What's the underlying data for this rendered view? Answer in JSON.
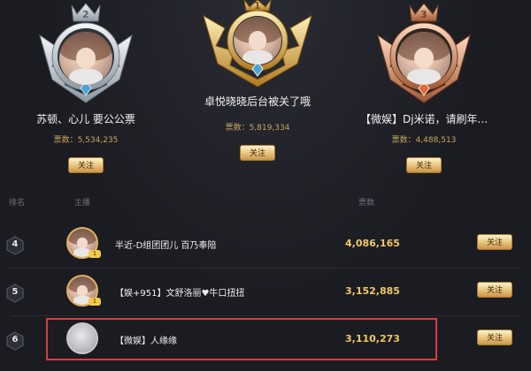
{
  "podium": [
    {
      "rank": "2",
      "name": "苏顿、心儿 要公公票",
      "fans_label": "票数：",
      "fans_value": "5,534,235",
      "follow_label": "关注",
      "tier": "silver"
    },
    {
      "rank": "1",
      "name": "卓悦晓晓后台被关了哦",
      "fans_label": "票数：",
      "fans_value": "5,819,334",
      "follow_label": "关注",
      "tier": "gold"
    },
    {
      "rank": "3",
      "name": "【微娱】Dj米诺，请刷年...",
      "fans_label": "票数：",
      "fans_value": "4,488,513",
      "follow_label": "关注",
      "tier": "bronze"
    }
  ],
  "list_header": {
    "rank": "排名",
    "host": "主播",
    "votes": "票数"
  },
  "rows": [
    {
      "rank": "4",
      "name": "半近-D组团团儿 百乃奉陪",
      "value": "4,086,165",
      "follow_label": "关注",
      "level": "1"
    },
    {
      "rank": "5",
      "name": "【娱+951】文舒洛丽♥牛口扭扭",
      "value": "3,152,885",
      "follow_label": "关注",
      "level": "1"
    },
    {
      "rank": "6",
      "name": "【微娱】人缘缘",
      "value": "3,110,273",
      "follow_label": "关注",
      "level": ""
    }
  ],
  "colors": {
    "accent_gold": "#f3c661",
    "highlight_red": "#e03b3b"
  }
}
